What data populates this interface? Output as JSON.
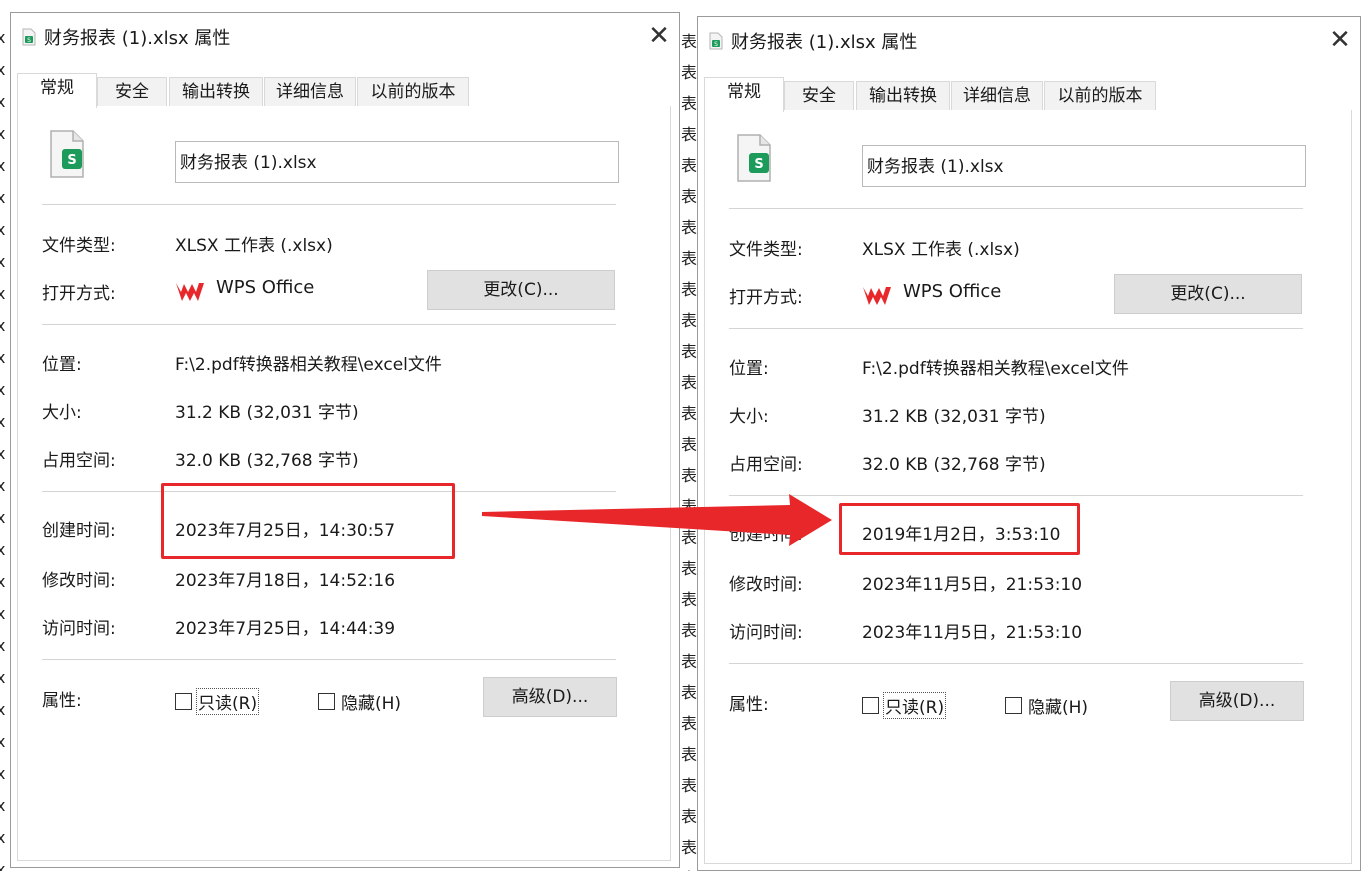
{
  "background": {
    "left_glyph": "x",
    "right_glyph": "表"
  },
  "dialogs": [
    {
      "title": "财务报表 (1).xlsx 属性",
      "close_glyph": "✕",
      "tabs": [
        "常规",
        "安全",
        "输出转换",
        "详细信息",
        "以前的版本"
      ],
      "active_tab": 0,
      "filename": "财务报表 (1).xlsx",
      "file_type_label": "文件类型:",
      "file_type": "XLSX 工作表 (.xlsx)",
      "open_with_label": "打开方式:",
      "open_with_app": "WPS Office",
      "change_button": "更改(C)...",
      "location_label": "位置:",
      "location": "F:\\2.pdf转换器相关教程\\excel文件",
      "size_label": "大小:",
      "size": "31.2 KB (32,031 字节)",
      "disk_size_label": "占用空间:",
      "disk_size": "32.0 KB (32,768 字节)",
      "created_label": "创建时间:",
      "created": "2023年7月25日，14:30:57",
      "modified_label": "修改时间:",
      "modified": "2023年7月18日，14:52:16",
      "accessed_label": "访问时间:",
      "accessed": "2023年7月25日，14:44:39",
      "attributes_label": "属性:",
      "readonly_label": "只读(R)",
      "hidden_label": "隐藏(H)",
      "advanced_button": "高级(D)..."
    },
    {
      "title": "财务报表 (1).xlsx 属性",
      "close_glyph": "✕",
      "tabs": [
        "常规",
        "安全",
        "输出转换",
        "详细信息",
        "以前的版本"
      ],
      "active_tab": 0,
      "filename": "财务报表 (1).xlsx",
      "file_type_label": "文件类型:",
      "file_type": "XLSX 工作表 (.xlsx)",
      "open_with_label": "打开方式:",
      "open_with_app": "WPS Office",
      "change_button": "更改(C)...",
      "location_label": "位置:",
      "location": "F:\\2.pdf转换器相关教程\\excel文件",
      "size_label": "大小:",
      "size": "31.2 KB (32,031 字节)",
      "disk_size_label": "占用空间:",
      "disk_size": "32.0 KB (32,768 字节)",
      "created_label": "创建时间:",
      "created": "2019年1月2日，3:53:10",
      "modified_label": "修改时间:",
      "modified": "2023年11月5日，21:53:10",
      "accessed_label": "访问时间:",
      "accessed": "2023年11月5日，21:53:10",
      "attributes_label": "属性:",
      "readonly_label": "只读(R)",
      "hidden_label": "隐藏(H)",
      "advanced_button": "高级(D)..."
    }
  ],
  "colors": {
    "highlight": "#e8272a",
    "sheet_icon": "#1d9b5b",
    "wps_logo": "#e8272a"
  },
  "icons": {
    "file": "spreadsheet-file-icon",
    "app": "wps-logo-icon",
    "close": "close-icon",
    "annotation": "red-arrow-annotation"
  }
}
